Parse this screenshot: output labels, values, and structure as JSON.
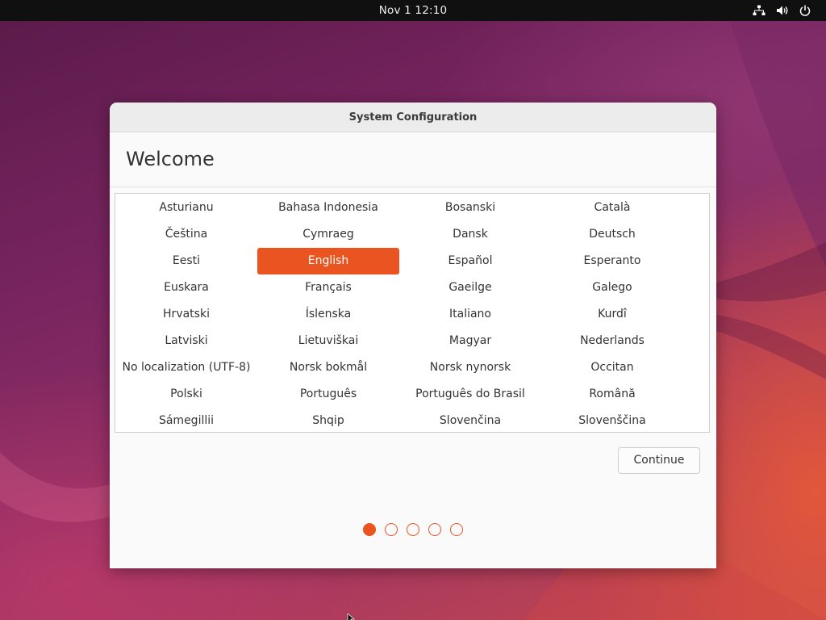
{
  "topbar": {
    "clock": "Nov 1  12:10",
    "tray_icons": [
      "network-icon",
      "volume-icon",
      "power-icon"
    ]
  },
  "dialog": {
    "title": "System Configuration",
    "heading": "Welcome",
    "languages": [
      [
        "Asturianu",
        "Bahasa Indonesia",
        "Bosanski",
        "Català"
      ],
      [
        "Čeština",
        "Cymraeg",
        "Dansk",
        "Deutsch"
      ],
      [
        "Eesti",
        "English",
        "Español",
        "Esperanto"
      ],
      [
        "Euskara",
        "Français",
        "Gaeilge",
        "Galego"
      ],
      [
        "Hrvatski",
        "Íslenska",
        "Italiano",
        "Kurdî"
      ],
      [
        "Latviski",
        "Lietuviškai",
        "Magyar",
        "Nederlands"
      ],
      [
        "No localization (UTF-8)",
        "Norsk bokmål",
        "Norsk nynorsk",
        "Occitan"
      ],
      [
        "Polski",
        "Português",
        "Português do Brasil",
        "Română"
      ],
      [
        "Sámegillii",
        "Shqip",
        "Slovenčina",
        "Slovenščina"
      ]
    ],
    "selected_language": "English",
    "continue_label": "Continue",
    "pager": {
      "total": 5,
      "current": 1
    }
  },
  "colors": {
    "accent": "#e95420",
    "topbar": "#101010"
  }
}
